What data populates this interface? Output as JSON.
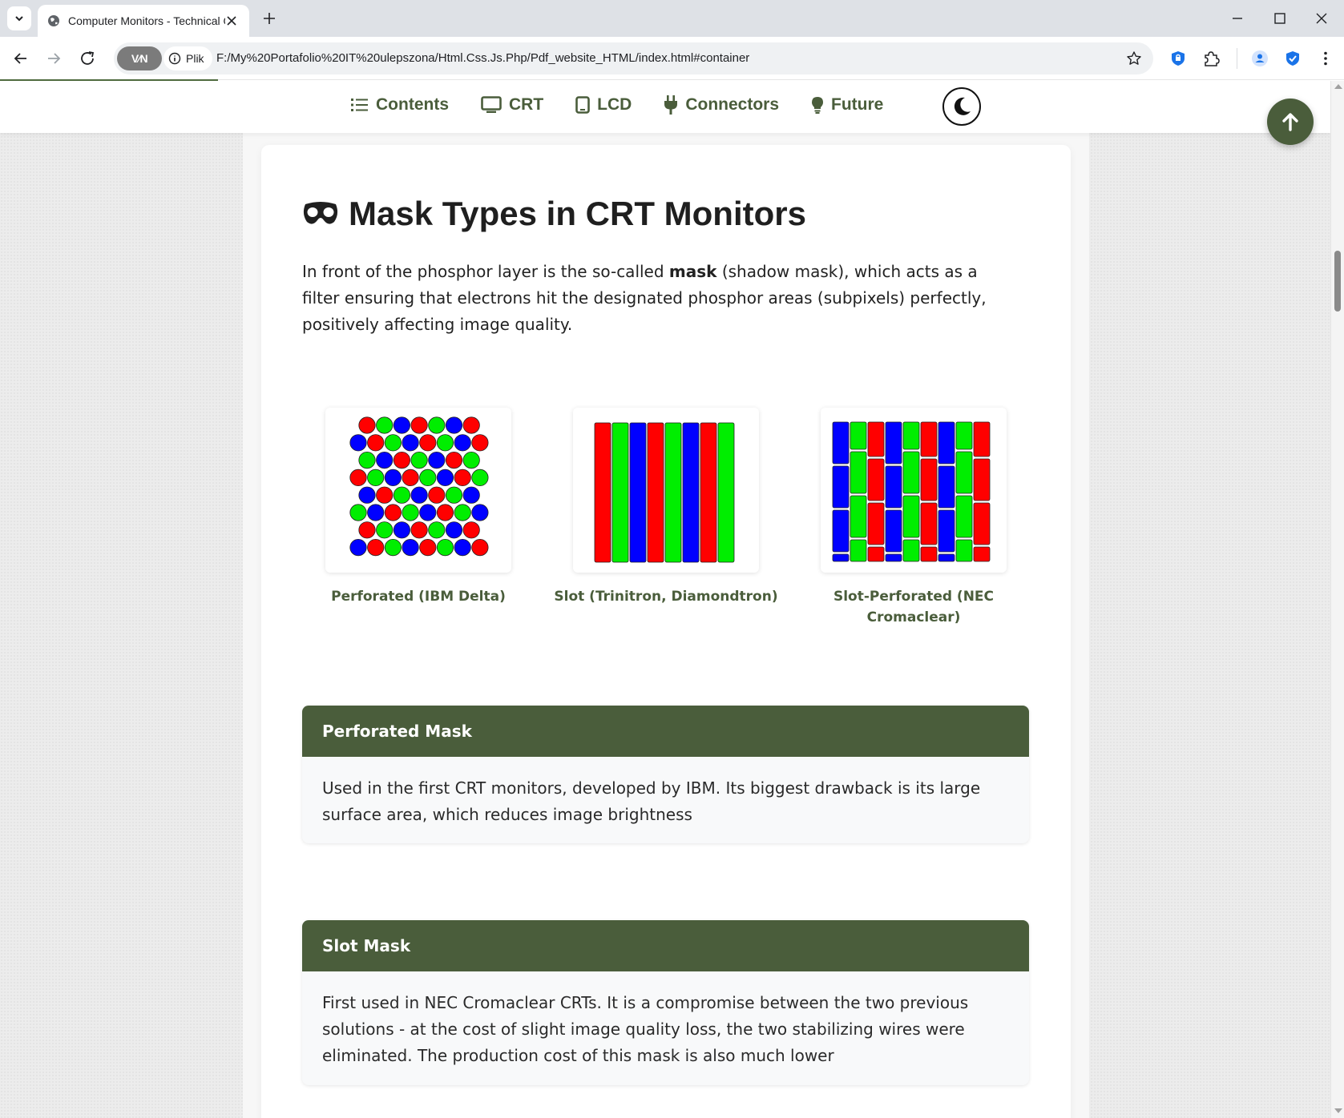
{
  "browser": {
    "tab_title": "Computer Monitors - Technical Overview",
    "vpn_label": "V⁄N",
    "file_chip_label": "Plik",
    "url": "F:/My%20Portafolio%20IT%20ulepszona/Html.Css.Js.Php/Pdf_website_HTML/index.html#container"
  },
  "nav": {
    "items": [
      {
        "label": "Contents",
        "icon": "list-icon"
      },
      {
        "label": "CRT",
        "icon": "desktop-icon"
      },
      {
        "label": "LCD",
        "icon": "tablet-icon"
      },
      {
        "label": "Connectors",
        "icon": "plug-icon"
      },
      {
        "label": "Future",
        "icon": "lightbulb-icon"
      }
    ],
    "theme_toggle_icon": "moon-icon",
    "back_to_top_icon": "arrow-up-icon"
  },
  "section": {
    "icon": "mask-icon",
    "title": "Mask Types in CRT Monitors",
    "intro_before": "In front of the phosphor layer is the so-called ",
    "intro_bold": "mask",
    "intro_after": " (shadow mask), which acts as a filter ensuring that electrons hit the designated phosphor areas (subpixels) perfectly, positively affecting image quality."
  },
  "figures": [
    {
      "caption": "Perforated (IBM Delta)",
      "image": "perforated-mask-diagram"
    },
    {
      "caption": "Slot (Trinitron, Diamondtron)",
      "image": "slot-mask-diagram"
    },
    {
      "caption": "Slot-Perforated (NEC Cromaclear)",
      "image": "slot-perforated-mask-diagram"
    }
  ],
  "info_boxes": [
    {
      "title": "Perforated Mask",
      "body": "Used in the first CRT monitors, developed by IBM. Its biggest drawback is its large surface area, which reduces image brightness"
    },
    {
      "title": "Slot Mask",
      "body": "First used in NEC Cromaclear CRTs. It is a compromise between the two previous solutions - at the cost of slight image quality loss, the two stabilizing wires were eliminated. The production cost of this mask is also much lower"
    }
  ],
  "colors": {
    "accent": "#4a5d3b",
    "phosphor_red": "#ff0000",
    "phosphor_green": "#00ee00",
    "phosphor_blue": "#0000ff"
  }
}
